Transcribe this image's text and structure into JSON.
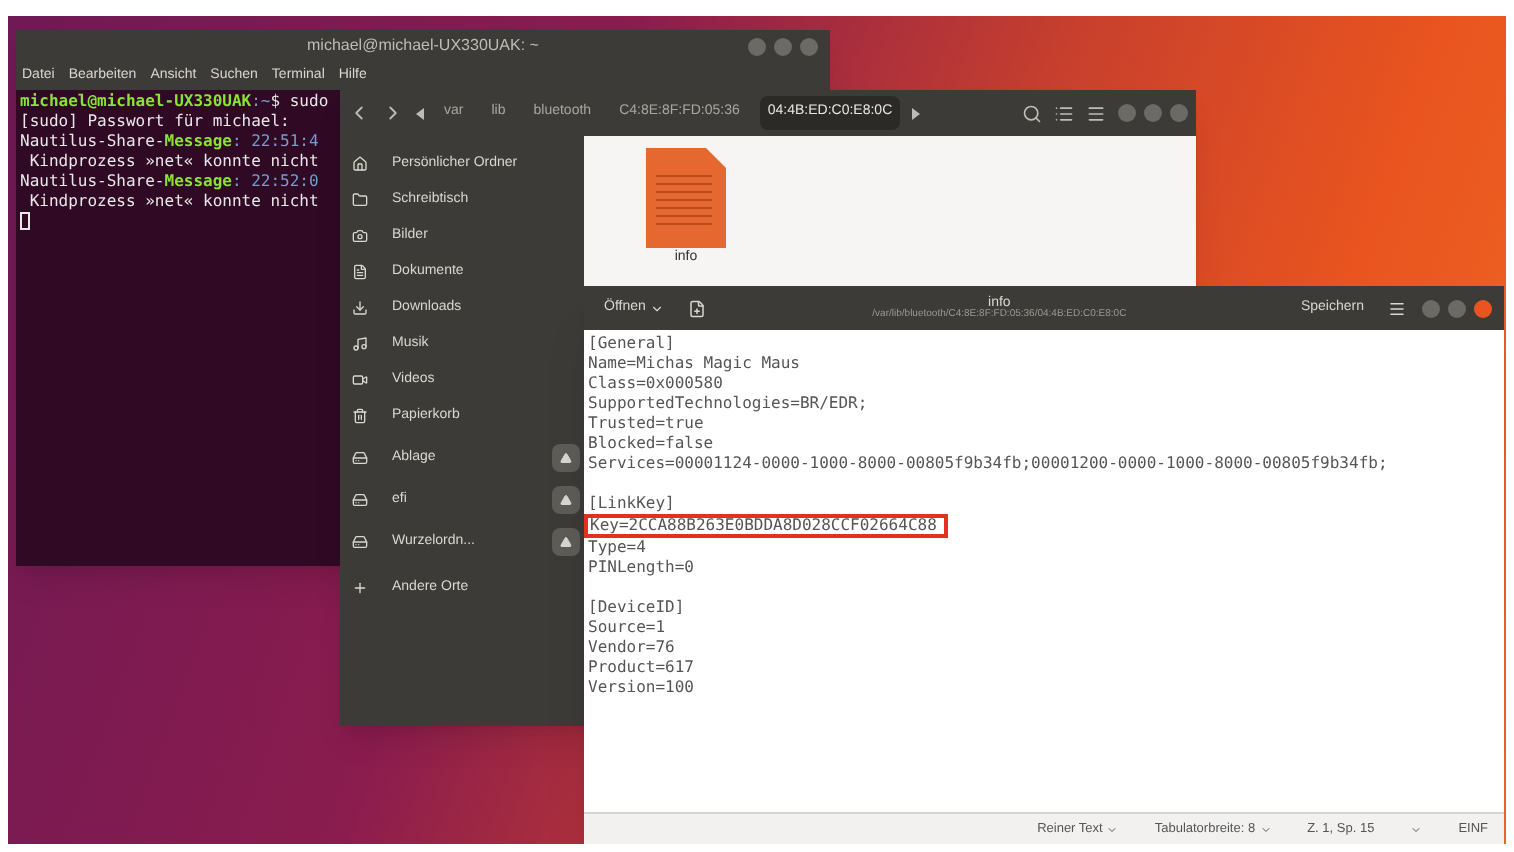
{
  "terminal": {
    "title": "michael@michael-UX330UAK: ~",
    "menu": [
      "Datei",
      "Bearbeiten",
      "Ansicht",
      "Suchen",
      "Terminal",
      "Hilfe"
    ],
    "lines": [
      {
        "kind": "prompt",
        "user": "michael@michael-UX330UAK",
        "text": ":~$ sudo"
      },
      {
        "kind": "plain",
        "text": "[sudo] Passwort für michael:"
      },
      {
        "kind": "message",
        "source": "Nautilus-Share-",
        "label": "Message",
        "time": ": 22:51:4"
      },
      {
        "kind": "plain",
        "text": " Kindprozess »net« konnte nicht"
      },
      {
        "kind": "message",
        "source": "Nautilus-Share-",
        "label": "Message",
        "time": ": 22:52:0"
      },
      {
        "kind": "plain",
        "text": " Kindprozess »net« konnte nicht"
      }
    ]
  },
  "files": {
    "path": [
      {
        "label": "var",
        "selected": false
      },
      {
        "label": "lib",
        "selected": false
      },
      {
        "label": "bluetooth",
        "selected": false
      },
      {
        "label": "C4:8E:8F:FD:05:36",
        "selected": false
      },
      {
        "label": "04:4B:ED:C0:E8:0C",
        "selected": true
      }
    ],
    "sidebar": [
      {
        "kind": "home",
        "label": "Persönlicher Ordner"
      },
      {
        "kind": "folder",
        "label": "Schreibtisch"
      },
      {
        "kind": "camera",
        "label": "Bilder"
      },
      {
        "kind": "doc",
        "label": "Dokumente"
      },
      {
        "kind": "download",
        "label": "Downloads"
      },
      {
        "kind": "music",
        "label": "Musik"
      },
      {
        "kind": "video",
        "label": "Videos"
      },
      {
        "kind": "trash",
        "label": "Papierkorb"
      },
      {
        "kind": "mount",
        "label": "Ablage"
      },
      {
        "kind": "mount",
        "label": "efi"
      },
      {
        "kind": "mount",
        "label": "Wurzelordn..."
      },
      {
        "kind": "plus",
        "label": "Andere Orte"
      }
    ],
    "items": [
      {
        "name": "info"
      }
    ]
  },
  "editor": {
    "open": "Öffnen",
    "title": "info",
    "subtitle": "/var/lib/bluetooth/C4:8E:8F:FD:05:36/04:4B:ED:C0:E8:0C",
    "save": "Speichern",
    "lines": [
      {
        "kind": "text",
        "text": "[General]"
      },
      {
        "kind": "text",
        "text": "Name=Michas Magic Maus"
      },
      {
        "kind": "text",
        "text": "Class=0x000580"
      },
      {
        "kind": "text",
        "text": "SupportedTechnologies=BR/EDR;"
      },
      {
        "kind": "text",
        "text": "Trusted=true"
      },
      {
        "kind": "text",
        "text": "Blocked=false"
      },
      {
        "kind": "text",
        "text": "Services=00001124-0000-1000-8000-00805f9b34fb;00001200-0000-1000-8000-00805f9b34fb;"
      },
      {
        "kind": "blank"
      },
      {
        "kind": "text",
        "text": "[LinkKey]"
      },
      {
        "kind": "boxed",
        "text": "Key=2CCA88B263E0BDDA8D028CCF02664C88"
      },
      {
        "kind": "text",
        "text": "Type=4"
      },
      {
        "kind": "text",
        "text": "PINLength=0"
      },
      {
        "kind": "blank"
      },
      {
        "kind": "text",
        "text": "[DeviceID]"
      },
      {
        "kind": "text",
        "text": "Source=1"
      },
      {
        "kind": "text",
        "text": "Vendor=76"
      },
      {
        "kind": "text",
        "text": "Product=617"
      },
      {
        "kind": "text",
        "text": "Version=100"
      }
    ],
    "status": {
      "syntax": "Reiner Text",
      "tabs": "Tabulatorbreite: 8",
      "position": "Z. 1, Sp. 15",
      "mode": "EINF"
    }
  }
}
